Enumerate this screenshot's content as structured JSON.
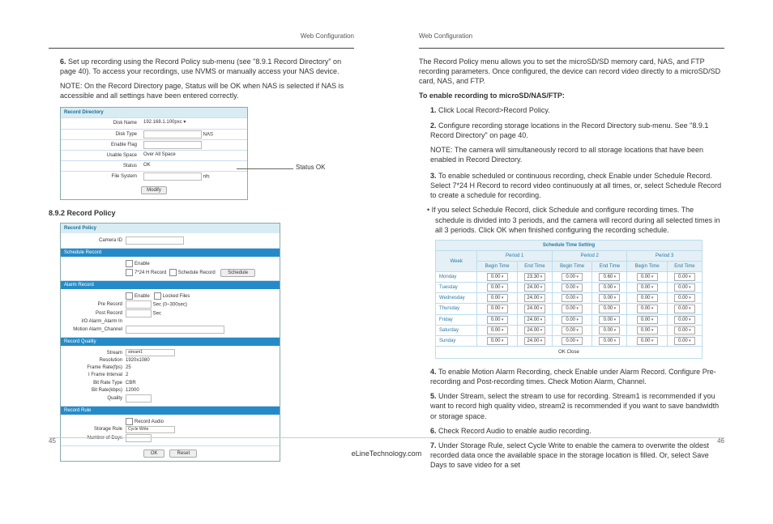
{
  "header": "Web Configuration",
  "left": {
    "step6": "Set up recording using the Record Policy sub-menu (see \"8.9.1 Record Directory\" on page 40). To access your recordings, use NVMS or manually access your NAS device.",
    "note": "NOTE: On the Record Directory page, Status will be OK when NAS is selected if NAS is accessible and all settings have been entered correctly.",
    "fig1": {
      "title": "Record Directory",
      "rows": {
        "disk": "Disk Name",
        "disk_val": "192.168.1.100pxc ▾",
        "type": "Disk Type",
        "type_val": "NAS",
        "enable": "Enable Flag",
        "usable": "Usable Space",
        "usable_val": "Over All Space",
        "status": "Status",
        "status_val": "OK",
        "filesys": "File System",
        "filesys_val": "nfs",
        "modify": "Modify"
      }
    },
    "callout": "Status OK",
    "heading": "8.9.2 Record Policy",
    "fig2": {
      "title": "Record Policy",
      "camera": "Camera ID",
      "bars": {
        "sched": "Schedule Record",
        "alarm": "Alarm Record",
        "quality": "Record Quality",
        "rule": "Record Rule"
      },
      "sched": {
        "enable": "Enable",
        "pre": "7*24 H Record",
        "sr": "Schedule Record",
        "sbtn": "Schedule"
      },
      "alarm": {
        "enable": "Enable",
        "locked": "Locked Files",
        "prerec": "Pre Record",
        "prerec_unit": "Sec (0~300sec)",
        "postrec": "Post Record",
        "postrec_unit": "Sec",
        "io": "I/O Alarm_Alarm In",
        "motion": "Motion Alarm_Channel"
      },
      "quality": {
        "stream": "Stream",
        "stream_val": "stream1",
        "resolution": "Resolution",
        "resolution_val": "1920x1080",
        "framerate": "Frame Rate(fps)",
        "framerate_val": "25",
        "iframe": "I Frame Interval",
        "iframe_val": "2",
        "brtype": "Bit Rate Type",
        "brtype_val": "CBR",
        "bitrate": "Bit Rate(kbps)",
        "bitrate_val": "12000",
        "qualityf": "Quality"
      },
      "rule": {
        "recaudio": "Record Audio",
        "storagerule": "Storage Rule",
        "storagerule_val": "Cycle Write",
        "days": "Number of Days"
      },
      "ok": "OK",
      "reset": "Reset"
    }
  },
  "right": {
    "intro": "The Record Policy menu allows you to set the microSD/SD memory card, NAS, and FTP recording parameters. Once configured, the device can record video directly to a microSD/SD card, NAS, and FTP.",
    "enable_h": "To enable recording to microSD/NAS/FTP:",
    "s1": "Click Local Record>Record Policy.",
    "s2": "Configure recording storage locations in the Record Directory sub-menu. See \"8.9.1 Record Directory\" on page 40.",
    "note2": "NOTE: The camera will simultaneously record to all storage locations that have been enabled in Record Directory.",
    "s3a": "To enable scheduled or continuous recording, check Enable under Schedule Record. Select 7*24 H Record to record video continuously at all times, or, select Schedule Record to create a schedule for recording.",
    "s3b": "If you select Schedule Record, click Schedule and configure recording times. The schedule is divided into 3 periods, and the camera will record during all selected times in all 3 periods. Click OK when finished configuring the recording schedule.",
    "sched_table": {
      "caption": "Schedule Time Setting",
      "periods": [
        "Period 1",
        "Period 2",
        "Period 3"
      ],
      "cols": [
        "Begin Time",
        "End Time"
      ],
      "rows": [
        {
          "day": "Monday",
          "cells": [
            "0.00",
            "23.30",
            "0.00",
            "0.60",
            "0.00",
            "0.00"
          ]
        },
        {
          "day": "Tuesday",
          "cells": [
            "0.00",
            "24.00",
            "0.00",
            "0.00",
            "0.00",
            "0.00"
          ]
        },
        {
          "day": "Wednesday",
          "cells": [
            "0.00",
            "24.00",
            "0.00",
            "0.00",
            "0.00",
            "0.00"
          ]
        },
        {
          "day": "Thursday",
          "cells": [
            "0.00",
            "24.00",
            "0.00",
            "0.00",
            "0.00",
            "0.00"
          ]
        },
        {
          "day": "Friday",
          "cells": [
            "0.00",
            "24.00",
            "0.00",
            "0.00",
            "0.00",
            "0.00"
          ]
        },
        {
          "day": "Saturday",
          "cells": [
            "0.00",
            "24.00",
            "0.00",
            "0.00",
            "0.00",
            "0.00"
          ]
        },
        {
          "day": "Sunday",
          "cells": [
            "0.00",
            "24.00",
            "0.00",
            "0.00",
            "0.00",
            "0.00"
          ]
        }
      ],
      "ok": "OK",
      "close": "Close"
    },
    "s4": "To enable Motion Alarm Recording, check Enable under Alarm Record. Configure Pre-recording and Post-recording times. Check Motion Alarm, Channel.",
    "s5": "Under Stream, select the stream to use for recording. Stream1 is recommended if you want to record high quality video, stream2 is recommended if you want to save bandwidth or storage space.",
    "s6": "Check Record Audio to enable audio recording.",
    "s7": "Under Storage Rule, select Cycle Write to enable the camera to overwrite the oldest recorded data once the available space in the storage location is filled. Or, select Save Days to save video for a set"
  },
  "footer": {
    "site": "eLineTechnology.com",
    "pl": "45",
    "pr": "46"
  }
}
